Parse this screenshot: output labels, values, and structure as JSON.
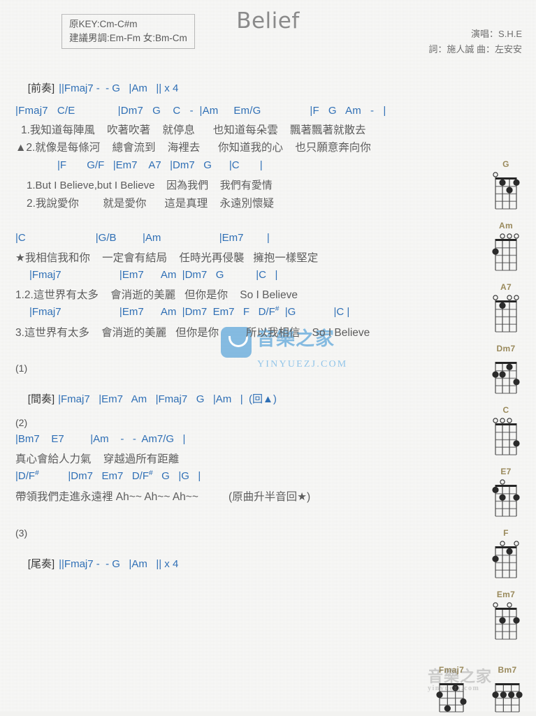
{
  "header": {
    "title": "Belief",
    "key_box": {
      "line1": "原KEY:Cm-C#m",
      "line2": "建議男調:Em-Fm 女:Bm-Cm"
    },
    "credits": {
      "singer": "演唱：S.H.E",
      "writers": "詞：施人誠  曲：左安安"
    }
  },
  "intro": {
    "label": "[前奏]",
    "chords": "||Fmaj7 -  - G   |Am   || x 4"
  },
  "verse1": {
    "chordline": "|Fmaj7   C/E              |Dm7   G    C   -  |Am     Em/G                |F   G   Am   -   |",
    "lyric1": "1.我知道每陣風    吹著吹著    就停息      也知道每朵雲    飄著飄著就散去",
    "lyric2": "▲2.就像是每條河    總會流到    海裡去      你知道我的心    也只願意奔向你"
  },
  "verse2": {
    "chordline": "|F       G/F   |Em7    A7   |Dm7   G      |C       |",
    "lyric1": "1.But I Believe,but I Believe    因為我們    我們有愛情",
    "lyric2": "2.我說愛你        就是愛你      這是真理    永遠別懷疑"
  },
  "chorus": {
    "chordline1": "|C                        |G/B         |Am                    |Em7        |",
    "lyric1": "★我相信我和你    一定會有結局    任時光再侵襲   擁抱一樣堅定",
    "chordline2": "|Fmaj7                    |Em7      Am  |Dm7   G           |C   |",
    "lyric2": "1.2.這世界有太多    會消逝的美麗   但你是你    So I Believe",
    "chordline3": "|Fmaj7                    |Em7      Am  |Dm7  Em7   F   D/F#  |G             |C |",
    "lyric3": "3.這世界有太多    會消逝的美麗   但你是你         所以我相信    So I Believe"
  },
  "interlude": {
    "number": "(1)",
    "label": "[間奏]",
    "chords": "|Fmaj7   |Em7   Am   |Fmaj7   G   |Am   |  (回▲)"
  },
  "bridge": {
    "number": "(2)",
    "chordline1": "|Bm7    E7         |Am    -   -  Am7/G   |",
    "lyric1": "真心會給人力氣    穿越過所有距離",
    "chordline2": "|D/F#          |Dm7   Em7   D/F#   G   |G   |",
    "lyric2": "帶領我們走進永遠裡 Ah~~ Ah~~ Ah~~          (原曲升半音回★)"
  },
  "outro": {
    "number": "(3)",
    "label": "[尾奏]",
    "chords": "||Fmaj7 -  - G   |Am   || x 4"
  },
  "watermark": {
    "brand": "音樂之家",
    "domain": "YINYUEZJ.COM",
    "logo_icon": "smile-logo-icon",
    "bottom_brand": "音樂之家",
    "bottom_domain": "yinyuezj.com"
  },
  "chord_diagrams": [
    {
      "name": "G",
      "open": [
        1,
        0,
        0,
        0
      ],
      "dots": [
        {
          "s": 2,
          "f": 1
        },
        {
          "s": 4,
          "f": 1
        },
        {
          "s": 3,
          "f": 2
        }
      ]
    },
    {
      "name": "Am",
      "open": [
        0,
        1,
        1,
        1
      ],
      "dots": [
        {
          "s": 1,
          "f": 2
        }
      ]
    },
    {
      "name": "A7",
      "open": [
        1,
        0,
        1,
        1
      ],
      "dots": [
        {
          "s": 2,
          "f": 1
        }
      ]
    },
    {
      "name": "Dm7",
      "open": [
        0,
        0,
        0,
        0
      ],
      "dots": [
        {
          "s": 3,
          "f": 1
        },
        {
          "s": 1,
          "f": 2
        },
        {
          "s": 2,
          "f": 2
        },
        {
          "s": 4,
          "f": 3
        }
      ]
    },
    {
      "name": "C",
      "open": [
        1,
        1,
        1,
        0
      ],
      "dots": [
        {
          "s": 4,
          "f": 3
        }
      ]
    },
    {
      "name": "E7",
      "open": [
        0,
        1,
        0,
        0
      ],
      "dots": [
        {
          "s": 1,
          "f": 1
        },
        {
          "s": 2,
          "f": 2
        },
        {
          "s": 4,
          "f": 2
        }
      ]
    },
    {
      "name": "F",
      "open": [
        0,
        1,
        0,
        1
      ],
      "dots": [
        {
          "s": 3,
          "f": 1
        },
        {
          "s": 1,
          "f": 2
        }
      ]
    },
    {
      "name": "Em7",
      "open": [
        1,
        0,
        1,
        0
      ],
      "dots": [
        {
          "s": 2,
          "f": 2
        },
        {
          "s": 4,
          "f": 2
        }
      ]
    }
  ],
  "chord_diagrams_bottom": [
    {
      "name": "Fmaj7",
      "open": [
        0,
        0,
        0,
        0
      ],
      "dots": [
        {
          "s": 3,
          "f": 1
        },
        {
          "s": 1,
          "f": 2
        },
        {
          "s": 4,
          "f": 3
        },
        {
          "s": 2,
          "f": 4
        }
      ]
    },
    {
      "name": "Bm7",
      "open": [
        0,
        0,
        0,
        0
      ],
      "dots": [
        {
          "s": 1,
          "f": 2
        },
        {
          "s": 2,
          "f": 2
        },
        {
          "s": 3,
          "f": 2
        },
        {
          "s": 4,
          "f": 2
        }
      ]
    }
  ],
  "colors": {
    "chord_blue": "#2f6fb5",
    "bar_olive": "#7a7a33",
    "lyric_grey": "#5c5c5c",
    "chordname_tan": "#9a8a5c",
    "watermark_blue": "#7fb8e0"
  }
}
